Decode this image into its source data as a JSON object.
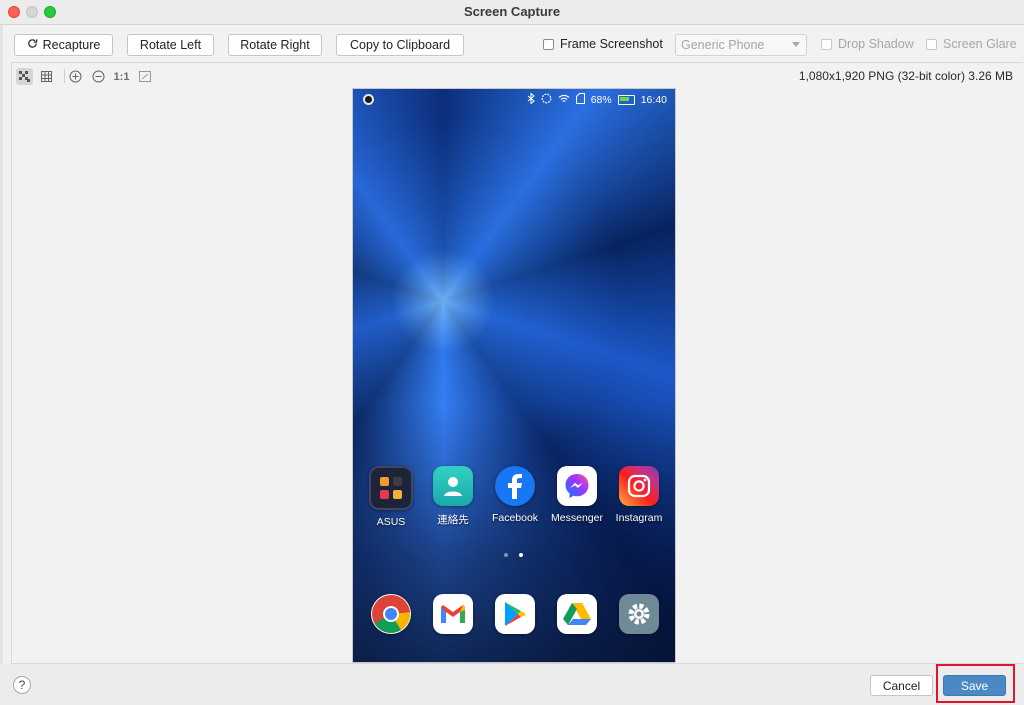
{
  "window": {
    "title": "Screen Capture"
  },
  "toolbar": {
    "recapture": "Recapture",
    "rotate_left": "Rotate Left",
    "rotate_right": "Rotate Right",
    "copy": "Copy to Clipboard",
    "frame_screenshot": "Frame Screenshot",
    "device_select": "Generic Phone",
    "drop_shadow": "Drop Shadow",
    "screen_glare": "Screen Glare"
  },
  "viewer": {
    "zoom_label": "1:1",
    "image_info": "1,080x1,920 PNG (32-bit color) 3.26 MB"
  },
  "phone": {
    "battery": "68%",
    "time": "16:40",
    "apps_row1": [
      {
        "label": "ASUS",
        "icon": "asus-folder-icon"
      },
      {
        "label": "連絡先",
        "icon": "contacts-icon"
      },
      {
        "label": "Facebook",
        "icon": "facebook-icon"
      },
      {
        "label": "Messenger",
        "icon": "messenger-icon"
      },
      {
        "label": "Instagram",
        "icon": "instagram-icon"
      }
    ],
    "dock": [
      {
        "icon": "chrome-icon"
      },
      {
        "icon": "gmail-icon"
      },
      {
        "icon": "play-store-icon"
      },
      {
        "icon": "google-drive-icon"
      },
      {
        "icon": "settings-icon"
      }
    ]
  },
  "footer": {
    "help": "?",
    "cancel": "Cancel",
    "save": "Save"
  },
  "colors": {
    "accent": "#4b89c6",
    "highlight": "#e0142b"
  }
}
